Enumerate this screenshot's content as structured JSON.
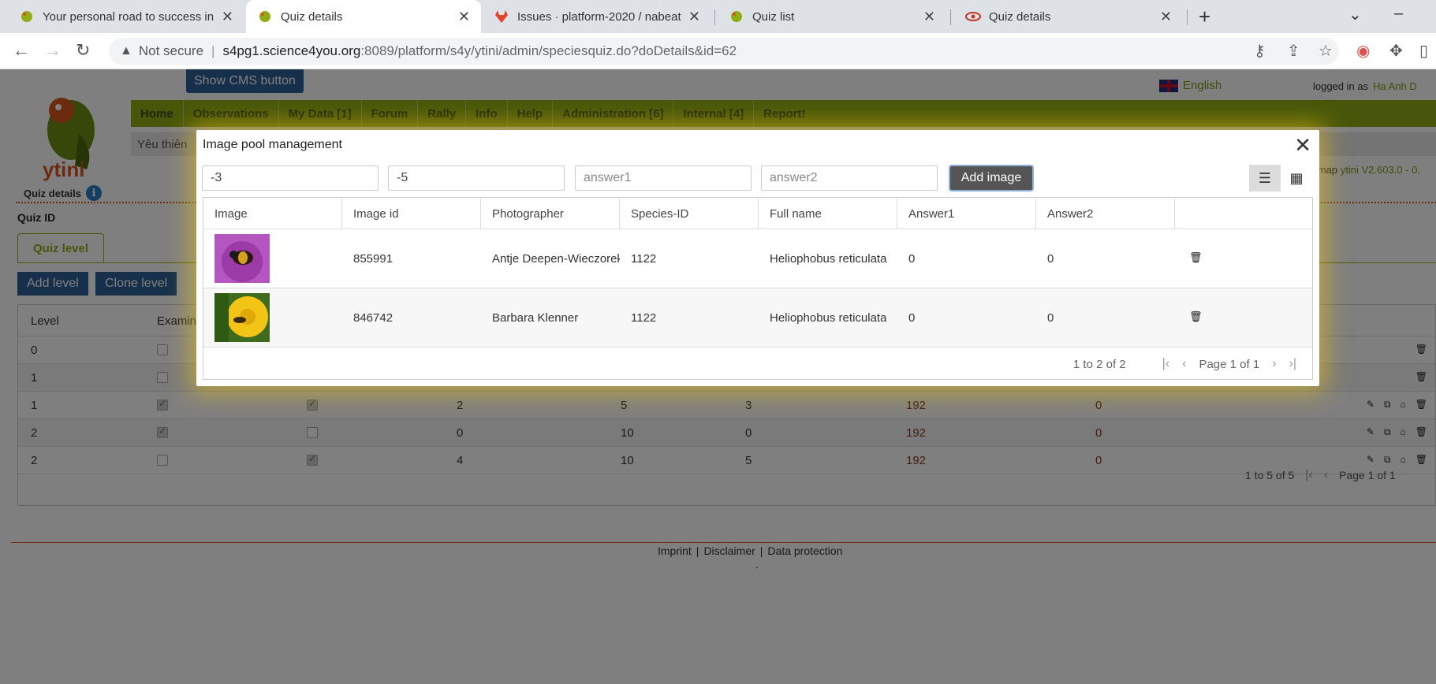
{
  "browser": {
    "tabs": [
      {
        "title": "Your personal road to success in",
        "close": "✕"
      },
      {
        "title": "Quiz details",
        "close": "✕"
      },
      {
        "title": "Issues · platform-2020 / nabeat ·",
        "close": "✕"
      },
      {
        "title": "Quiz list",
        "close": "✕"
      },
      {
        "title": "Quiz details",
        "close": "✕"
      }
    ],
    "new_tab": "+",
    "not_secure": "Not secure",
    "url_host": "s4pg1.science4you.org",
    "url_path": ":8089/platform/s4y/ytini/admin/speciesquiz.do?doDetails&id=62"
  },
  "page": {
    "cms_button": "Show CMS button",
    "logo_text": "ytini",
    "quiz_details_label": "Quiz details",
    "info_icon": "i",
    "language": "English",
    "logged_in_label": "logged in as",
    "username": "Ha Anh D",
    "nav": [
      "Home",
      "Observations",
      "My Data [1]",
      "Forum",
      "Rally",
      "Info",
      "Help",
      "Administration [6]",
      "Internal [4]",
      "Report!"
    ],
    "subbar_text": "Yêu thiên",
    "sitemap": "temap",
    "version": "ytini V2.603.0 - 0.",
    "quiz_id_label": "Quiz ID",
    "quiz_level_tab": "Quiz level",
    "add_level": "Add level",
    "clone_level": "Clone level",
    "levels_table": {
      "headers": [
        "Level",
        "Examin"
      ],
      "rows": [
        {
          "level": "0",
          "c1": "",
          "c2": "",
          "c3": "",
          "c4": "",
          "c5": "",
          "c6": ""
        },
        {
          "level": "1",
          "c1": "",
          "c2": "",
          "c3": "",
          "c4": "",
          "c5": "",
          "c6": ""
        },
        {
          "level": "1",
          "c1": "2",
          "c2": "5",
          "c3": "3",
          "c4": "192",
          "c5": "0"
        },
        {
          "level": "2",
          "c1": "0",
          "c2": "10",
          "c3": "0",
          "c4": "192",
          "c5": "0"
        },
        {
          "level": "2",
          "c1": "4",
          "c2": "10",
          "c3": "5",
          "c4": "192",
          "c5": "0"
        }
      ],
      "pager_range": "1 to 5 of 5",
      "pager_page": "Page 1 of 1"
    },
    "footer_links": [
      "Imprint",
      "|",
      "Disclaimer",
      "|",
      "Data protection"
    ],
    "footer_dot": "."
  },
  "modal": {
    "title": "Image pool management",
    "close": "✕",
    "inputs": [
      {
        "value": "-3"
      },
      {
        "value": "-5"
      },
      {
        "placeholder": "answer1"
      },
      {
        "placeholder": "answer2"
      }
    ],
    "add_image": "Add image",
    "columns": [
      "Image",
      "Image id",
      "Photographer",
      "Species-ID",
      "Full name",
      "Answer1",
      "Answer2"
    ],
    "rows": [
      {
        "image_id": "855991",
        "photographer": "Antje Deepen-Wieczorek",
        "species_id": "1122",
        "full_name": "Heliophobus reticulata",
        "answer1": "0",
        "answer2": "0"
      },
      {
        "image_id": "846742",
        "photographer": "Barbara Klenner",
        "species_id": "1122",
        "full_name": "Heliophobus reticulata",
        "answer1": "0",
        "answer2": "0"
      }
    ],
    "pager_range": "1 to 2 of 2",
    "pager_page": "Page 1 of 1"
  }
}
